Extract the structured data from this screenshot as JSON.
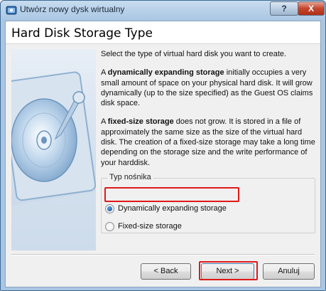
{
  "window": {
    "title": "Utwórz nowy dysk wirtualny",
    "help_label": "?",
    "close_label": "X"
  },
  "header": {
    "title": "Hard Disk Storage Type"
  },
  "content": {
    "intro": "Select the type of virtual hard disk you want to create.",
    "dynamic_bold": "dynamically expanding storage",
    "dynamic_pre": "A ",
    "dynamic_rest": " initially occupies a very small amount of space on your physical hard disk. It will grow dynamically (up to the size specified) as the Guest OS claims disk space.",
    "fixed_pre": "A ",
    "fixed_bold": "fixed-size storage",
    "fixed_rest": " does not grow. It is stored in a file of approximately the same size as the size of the virtual hard disk. The creation of a fixed-size storage may take a long time depending on the storage size and the write performance of your harddisk."
  },
  "storage_group": {
    "title": "Typ nośnika",
    "options": [
      {
        "label": "Dynamically expanding storage",
        "selected": true
      },
      {
        "label": "Fixed-size storage",
        "selected": false
      }
    ]
  },
  "buttons": {
    "back": "< Back",
    "next": "Next >",
    "cancel": "Anuluj"
  },
  "colors": {
    "highlight": "#e11919",
    "title_bar": "#a9c6e3"
  },
  "icons": {
    "app": "virtualbox-icon",
    "watermark": "hard-disk-illustration"
  }
}
